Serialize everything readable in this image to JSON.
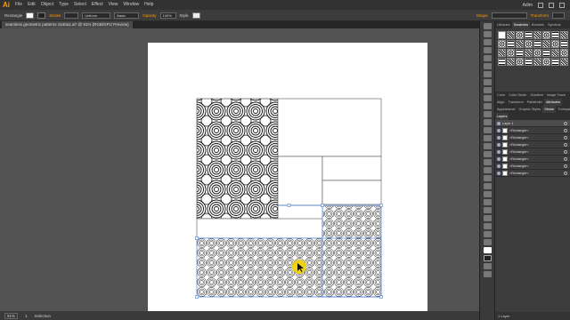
{
  "app": {
    "logo": "Ai",
    "menu": [
      "File",
      "Edit",
      "Object",
      "Type",
      "Select",
      "Effect",
      "View",
      "Window",
      "Help"
    ],
    "workspace": "Adim",
    "window_controls": [
      "minimize",
      "maximize",
      "close"
    ]
  },
  "controlbar": {
    "tool_name": "Rectangle",
    "stroke_label": "Stroke",
    "stroke_value": "",
    "brush_label": "Uniform",
    "basic_label": "Basic",
    "opacity_label": "Opacity",
    "opacity_value": "100%",
    "style_label": "Style",
    "shape_label": "Shape",
    "transform_label": "Transform"
  },
  "document": {
    "tab_title": "seamless geometric patterns 1540a1.ai* @ 91% (RGB/GPU Preview)"
  },
  "statusbar": {
    "zoom": "91%",
    "page": "1",
    "tool": "Selection"
  },
  "panels": {
    "top_tabs": [
      "Libraries",
      "Swatches",
      "Brushes",
      "Symbols"
    ],
    "active_top_tab": "Swatches",
    "mid_tabs_1": [
      "Color",
      "Color Guide",
      "Gradient",
      "Image Trace"
    ],
    "mid_tabs_2": [
      "Align",
      "Transform",
      "Pathfinder",
      "Attributes"
    ],
    "mid_tabs_3": [
      "Appearance",
      "Graphic Styles",
      "Stroke",
      "Transparency"
    ],
    "layers_tab": "Layers",
    "layers": {
      "parent": "Layer 1",
      "children": [
        "<Rectangle>",
        "<Rectangle>",
        "<Rectangle>",
        "<Rectangle>",
        "<Rectangle>",
        "<Rectangle>",
        "<Rectangle>"
      ]
    },
    "footer": "1 Layer"
  },
  "colors": {
    "accent": "#ff9a00",
    "selection_blue": "#4a7fd6",
    "cursor_highlight": "#f2d200"
  },
  "icons": {
    "logo": "illustrator-logo-icon",
    "cursor": "selection-cursor-icon"
  }
}
